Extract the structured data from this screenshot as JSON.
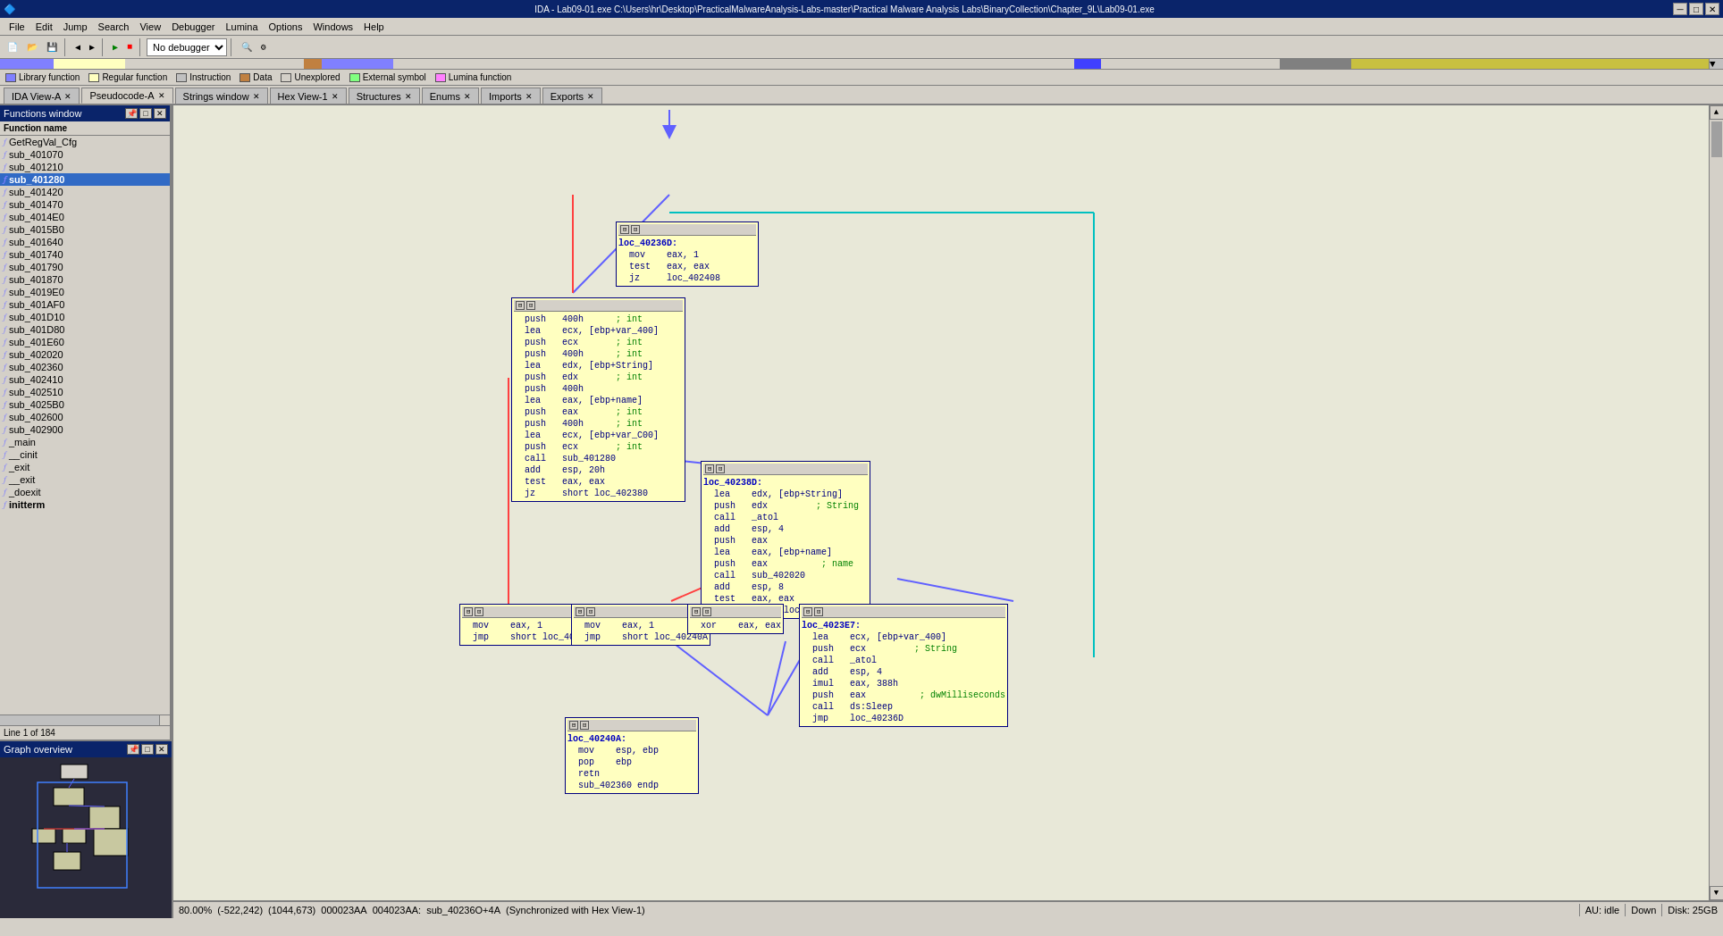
{
  "titlebar": {
    "title": "IDA - Lab09-01.exe C:\\Users\\hr\\Desktop\\PracticalMalwareAnalysis-Labs-master\\Practical Malware Analysis Labs\\BinaryCollection\\Chapter_9L\\Lab09-01.exe",
    "minimize": "─",
    "restore": "□",
    "close": "✕"
  },
  "menubar": {
    "items": [
      "File",
      "Edit",
      "Jump",
      "Search",
      "View",
      "Debugger",
      "Lumina",
      "Options",
      "Windows",
      "Help"
    ]
  },
  "legend": {
    "items": [
      {
        "label": "Library function",
        "color": "#8080ff"
      },
      {
        "label": "Regular function",
        "color": "#ffffc0"
      },
      {
        "label": "Instruction",
        "color": "#c0c0c0"
      },
      {
        "label": "Data",
        "color": "#c08040"
      },
      {
        "label": "Unexplored",
        "color": "#d4d0c8"
      },
      {
        "label": "External symbol",
        "color": "#80ff80"
      },
      {
        "label": "Lumina function",
        "color": "#ff80ff"
      }
    ]
  },
  "tabs": [
    {
      "label": "IDA View-A",
      "active": false,
      "closeable": true
    },
    {
      "label": "Pseudocode-A",
      "active": false,
      "closeable": true
    },
    {
      "label": "Strings window",
      "active": false,
      "closeable": true
    },
    {
      "label": "Hex View-1",
      "active": false,
      "closeable": true
    },
    {
      "label": "Structures",
      "active": false,
      "closeable": true
    },
    {
      "label": "Enums",
      "active": false,
      "closeable": true
    },
    {
      "label": "Imports",
      "active": false,
      "closeable": true
    },
    {
      "label": "Exports",
      "active": false,
      "closeable": true
    }
  ],
  "functions_panel": {
    "title": "Functions window",
    "column_header": "Function name",
    "items": [
      {
        "name": "GetRegVal_Cfg",
        "icon": "f"
      },
      {
        "name": "sub_401070",
        "icon": "f"
      },
      {
        "name": "sub_401210",
        "icon": "f"
      },
      {
        "name": "sub_401280",
        "icon": "f",
        "active": true
      },
      {
        "name": "sub_401420",
        "icon": "f"
      },
      {
        "name": "sub_401470",
        "icon": "f"
      },
      {
        "name": "sub_4014E0",
        "icon": "f"
      },
      {
        "name": "sub_4015B0",
        "icon": "f"
      },
      {
        "name": "sub_401640",
        "icon": "f"
      },
      {
        "name": "sub_401740",
        "icon": "f"
      },
      {
        "name": "sub_401790",
        "icon": "f"
      },
      {
        "name": "sub_401870",
        "icon": "f"
      },
      {
        "name": "sub_4019E0",
        "icon": "f"
      },
      {
        "name": "sub_401AF0",
        "icon": "f"
      },
      {
        "name": "sub_401D10",
        "icon": "f"
      },
      {
        "name": "sub_401D80",
        "icon": "f"
      },
      {
        "name": "sub_401E60",
        "icon": "f"
      },
      {
        "name": "sub_402020",
        "icon": "f"
      },
      {
        "name": "sub_402360",
        "icon": "f"
      },
      {
        "name": "sub_402410",
        "icon": "f"
      },
      {
        "name": "sub_402510",
        "icon": "f"
      },
      {
        "name": "sub_4025B0",
        "icon": "f"
      },
      {
        "name": "sub_402600",
        "icon": "f"
      },
      {
        "name": "sub_402900",
        "icon": "f"
      },
      {
        "name": "_main",
        "icon": "f"
      },
      {
        "name": "__cinit",
        "icon": "f"
      },
      {
        "name": "_exit",
        "icon": "f"
      },
      {
        "name": "__exit",
        "icon": "f"
      },
      {
        "name": "_doexit",
        "icon": "f"
      },
      {
        "name": "initterm",
        "icon": "f"
      }
    ],
    "status": "Line 1 of 184"
  },
  "graph_overview": {
    "title": "Graph overview"
  },
  "statusbar": {
    "zoom": "80.00%",
    "coords": "(-522,242)",
    "addr1": "(1044,673)",
    "addr2": "000023AA",
    "addr3": "004023AA:",
    "info": "sub_40236O+4A",
    "sync": "(Synchronized with Hex View-1)",
    "mode": "AU: idle",
    "scroll": "Down",
    "disk": "Disk: 25GB"
  },
  "debugger": {
    "value": "No debugger"
  },
  "code_blocks": {
    "block1": {
      "label": "loc_40236D:",
      "lines": [
        "mov    eax, 1",
        "test   eax, eax",
        "jz     loc_402408"
      ]
    },
    "block2": {
      "label": "",
      "lines": [
        "push   400h      ; int",
        "lea    ecx, [ebp+var_400]",
        "push   ecx       ; int",
        "push   400h      ; int",
        "lea    edx, [ebp+String]",
        "push   edx       ; int",
        "push   400h",
        "lea    eax, [ebp+name]",
        "push   eax       ; int",
        "push   400h      ; int",
        "lea    ecx, [ebp+var_C00]",
        "push   ecx       ; int",
        "call   sub_401280",
        "add    esp, 20h",
        "test   eax, eax",
        "jz     short loc_402380"
      ]
    },
    "block3": {
      "label": "loc_40238D:",
      "lines": [
        "lea    edx, [ebp+String]",
        "push   edx         ; String",
        "call   _atol",
        "add    esp, 4",
        "push   eax",
        "lea    eax, [ebp+name]",
        "push   eax          ; name",
        "call   sub_402020",
        "add    esp, 8",
        "test   eax, eax",
        "jz     short loc_4023E7"
      ]
    },
    "block4": {
      "label": "",
      "lines": [
        "mov    eax, 1",
        "jmp    short loc_40240A"
      ]
    },
    "block5": {
      "label": "",
      "lines": [
        "mov    eax, 1",
        "jmp    short loc_40240A"
      ]
    },
    "block6": {
      "label": "",
      "lines": [
        "xor    eax, eax"
      ]
    },
    "block7": {
      "label": "loc_4023E7:",
      "lines": [
        "lea    ecx, [ebp+var_400]",
        "push   ecx         ; String",
        "call   _atol",
        "add    esp, 4",
        "imul   eax, 388h",
        "push   eax          ; dwMilliseconds",
        "call   ds:Sleep",
        "jmp    loc_40236D"
      ]
    },
    "block8": {
      "label": "loc_40240A:",
      "lines": [
        "mov    esp, ebp",
        "pop    ebp",
        "retn",
        "sub_402360 endp"
      ]
    }
  }
}
